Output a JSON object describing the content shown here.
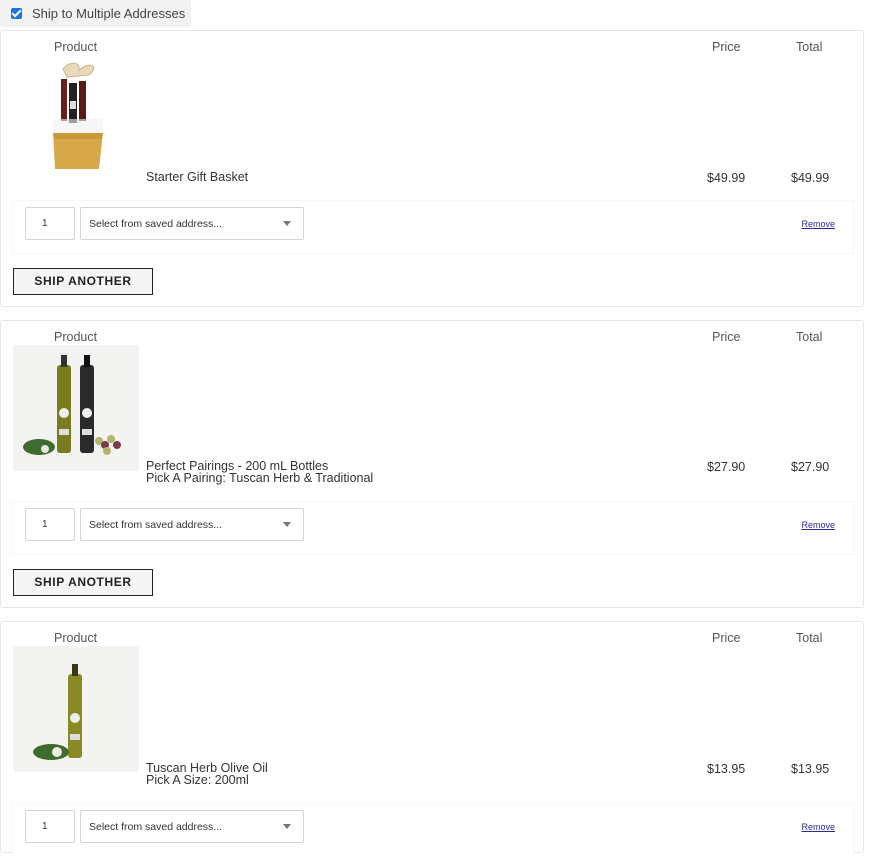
{
  "ship_multiple": {
    "label": "Ship to Multiple Addresses",
    "checked": true
  },
  "headers": {
    "product": "Product",
    "price": "Price",
    "total": "Total"
  },
  "address_placeholder": "Select from saved address...",
  "remove_label": "Remove",
  "ship_another_label": "SHIP ANOTHER",
  "items": [
    {
      "name": "Starter Gift Basket",
      "option": "",
      "price": "$49.99",
      "total": "$49.99",
      "qty": "1",
      "image": "gift-basket-image"
    },
    {
      "name": "Perfect Pairings - 200 mL Bottles",
      "option": "Pick A Pairing: Tuscan Herb & Traditional",
      "price": "$27.90",
      "total": "$27.90",
      "qty": "1",
      "image": "oil-vinegar-pair-image"
    },
    {
      "name": "Tuscan Herb Olive Oil",
      "option": "Pick A Size: 200ml",
      "price": "$13.95",
      "total": "$13.95",
      "qty": "1",
      "image": "olive-oil-bottle-image"
    }
  ],
  "colors": {
    "checkbox": "#1a73e8",
    "link": "#2a2a9a",
    "border": "#e6e6e6"
  }
}
